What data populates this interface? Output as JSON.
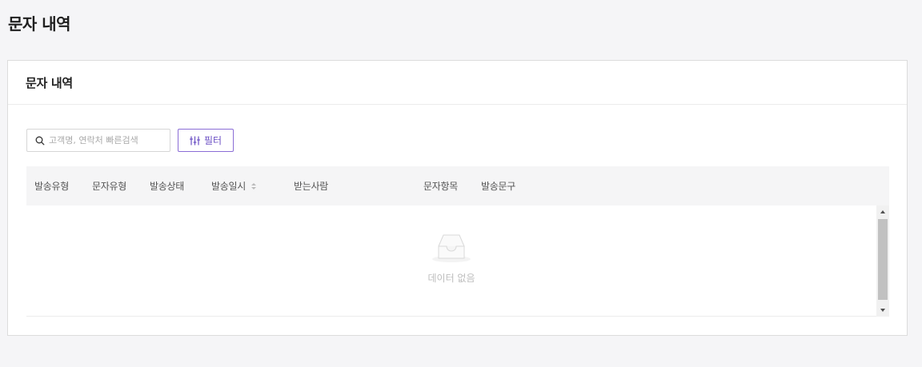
{
  "page": {
    "title": "문자 내역"
  },
  "card": {
    "title": "문자 내역"
  },
  "toolbar": {
    "search_placeholder": "고객명, 연락처 빠른검색",
    "filter_label": "필터"
  },
  "table": {
    "columns": [
      "발송유형",
      "문자유형",
      "발송상태",
      "발송일시",
      "받는사람",
      "문자항목",
      "발송문구"
    ],
    "sortable_column": "발송일시",
    "rows": [],
    "empty_text": "데이터 없음"
  },
  "colors": {
    "accent": "#6b4fc4",
    "accent_border": "#8b6dd6",
    "background": "#f5f5f7",
    "header_bg": "#f5f5f6"
  },
  "icons": {
    "search": "search-icon",
    "filter": "sliders-icon",
    "sort": "sort-icon",
    "empty": "empty-inbox-icon"
  }
}
